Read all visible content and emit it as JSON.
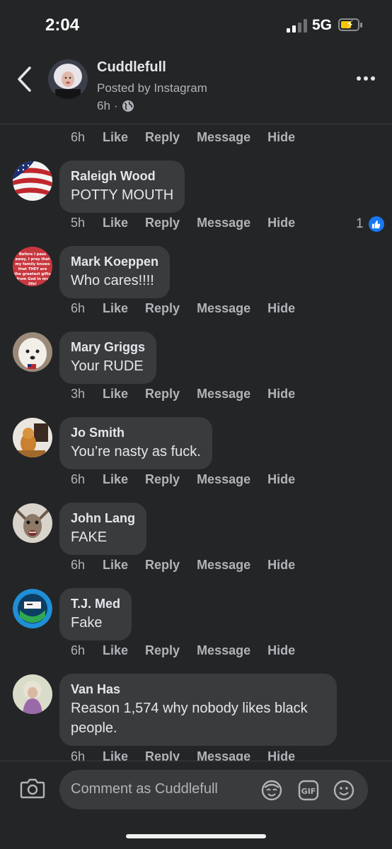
{
  "status_bar": {
    "time": "2:04",
    "network": "5G"
  },
  "header": {
    "page_name": "Cuddlefull",
    "posted_by": "Posted by Instagram",
    "time_ago": "6h",
    "separator": "·"
  },
  "actions": {
    "like": "Like",
    "reply": "Reply",
    "message": "Message",
    "hide": "Hide"
  },
  "top_action_row": {
    "time": "6h"
  },
  "comments": [
    {
      "author": "Raleigh Wood",
      "text": "POTTY MOUTH",
      "time": "5h",
      "reaction_count": "1"
    },
    {
      "author": "Mark Koeppen",
      "text": "Who cares!!!!",
      "time": "6h",
      "avatar_caption": "Before I pass away, I pray that my family knows that THEY are the greatest gifts from God in my life!"
    },
    {
      "author": "Mary Griggs",
      "text": "Your RUDE",
      "time": "3h"
    },
    {
      "author": "Jo Smith",
      "text": "You’re nasty as fuck.",
      "time": "6h"
    },
    {
      "author": "John Lang",
      "text": "FAKE",
      "time": "6h"
    },
    {
      "author": "T.J. Med",
      "text": "Fake",
      "time": "6h"
    },
    {
      "author": "Van Has",
      "text_line1": "Reason 1,574 why nobody likes black",
      "text_line2": "people.",
      "time": "6h"
    }
  ],
  "composer": {
    "placeholder": "Comment as Cuddlefull"
  },
  "colors": {
    "background": "#242526",
    "bubble": "#3a3b3c",
    "accent": "#1877f2",
    "muted": "#b0b3b8"
  },
  "icons": [
    "back-chevron-icon",
    "globe-icon",
    "more-icon",
    "like-thumb-icon",
    "camera-icon",
    "avatar-sticker-icon",
    "gif-icon",
    "emoji-icon"
  ]
}
